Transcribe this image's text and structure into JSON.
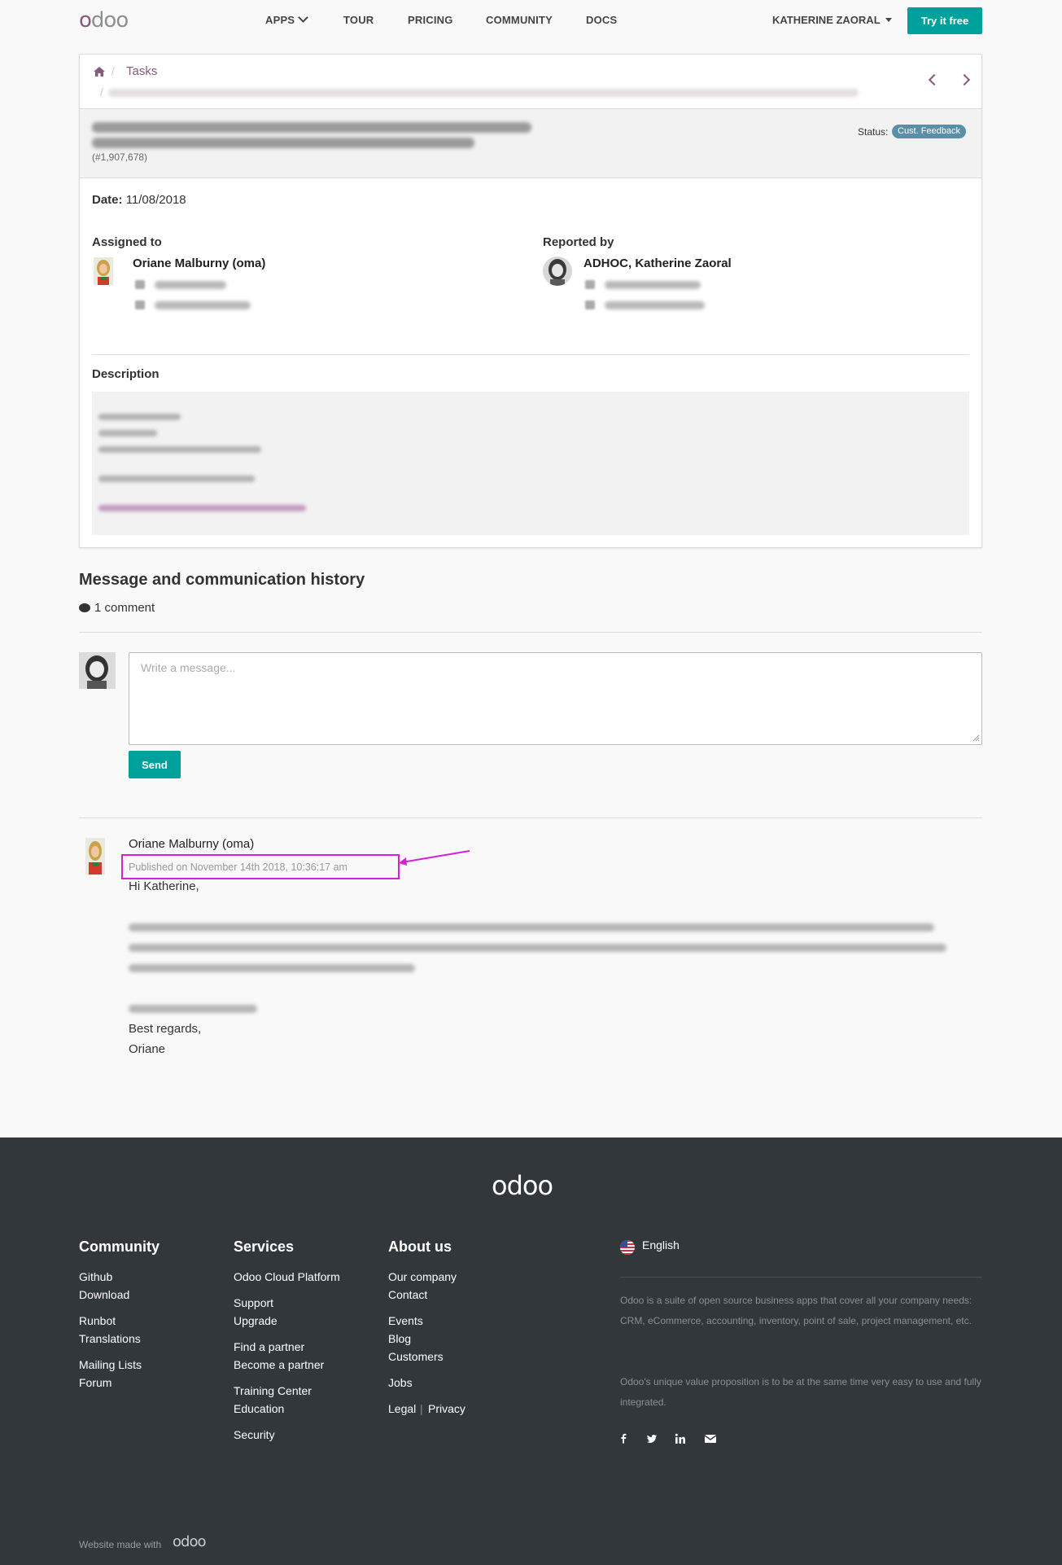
{
  "navbar": {
    "logo_first": "o",
    "logo_rest": "doo",
    "items": [
      "APPS",
      "TOUR",
      "PRICING",
      "COMMUNITY",
      "DOCS"
    ],
    "user": "KATHERINE ZAORAL",
    "try_label": "Try it free"
  },
  "breadcrumb": {
    "tasks": "Tasks"
  },
  "task": {
    "ref": "(#1,907,678)",
    "status_label": "Status:",
    "status_value": "Cust. Feedback",
    "date_label": "Date:",
    "date_value": "11/08/2018",
    "assigned_label": "Assigned to",
    "assigned_name": "Oriane Malburny (oma)",
    "reported_label": "Reported by",
    "reported_name": "ADHOC, Katherine Zaoral",
    "description_label": "Description"
  },
  "history": {
    "title": "Message and communication history",
    "count": "1 comment",
    "placeholder": "Write a message...",
    "send_label": "Send"
  },
  "post": {
    "author": "Oriane Malburny (oma)",
    "date": "Published on November 14th 2018, 10:36:17 am",
    "greeting": "Hi Katherine,",
    "closing": "Best regards,",
    "signature": "Oriane"
  },
  "footer": {
    "logo": "odoo",
    "community_title": "Community",
    "community_links": [
      "Github",
      "Download",
      "Runbot",
      "Translations",
      "Mailing Lists",
      "Forum"
    ],
    "services_title": "Services",
    "services_links": [
      "Odoo Cloud Platform",
      "Support",
      "Upgrade",
      "Find a partner",
      "Become a partner",
      "Training Center",
      "Education",
      "Security"
    ],
    "about_title": "About us",
    "about_links": [
      "Our company",
      "Contact",
      "Events",
      "Blog",
      "Customers",
      "Jobs",
      "Legal",
      "Privacy"
    ],
    "legal_sep": "|",
    "language": "English",
    "para1": "Odoo is a suite of open source business apps that cover all your company needs: CRM, eCommerce, accounting, inventory, point of sale, project management, etc.",
    "para2": "Odoo's unique value proposition is to be at the same time very easy to use and fully integrated.",
    "made_with": "Website made with",
    "made_logo": "odoo"
  },
  "colors": {
    "brand": "#875a7b",
    "accent": "#00a09d",
    "footer_bg": "#32373c",
    "annotation": "#d420d9"
  },
  "icons": [
    "home-icon",
    "chevron-left-icon",
    "chevron-right-icon",
    "phone-icon",
    "envelope-icon",
    "comments-icon",
    "flag-us-icon",
    "facebook-icon",
    "twitter-icon",
    "linkedin-icon",
    "mail-icon",
    "arrow-annotation"
  ]
}
